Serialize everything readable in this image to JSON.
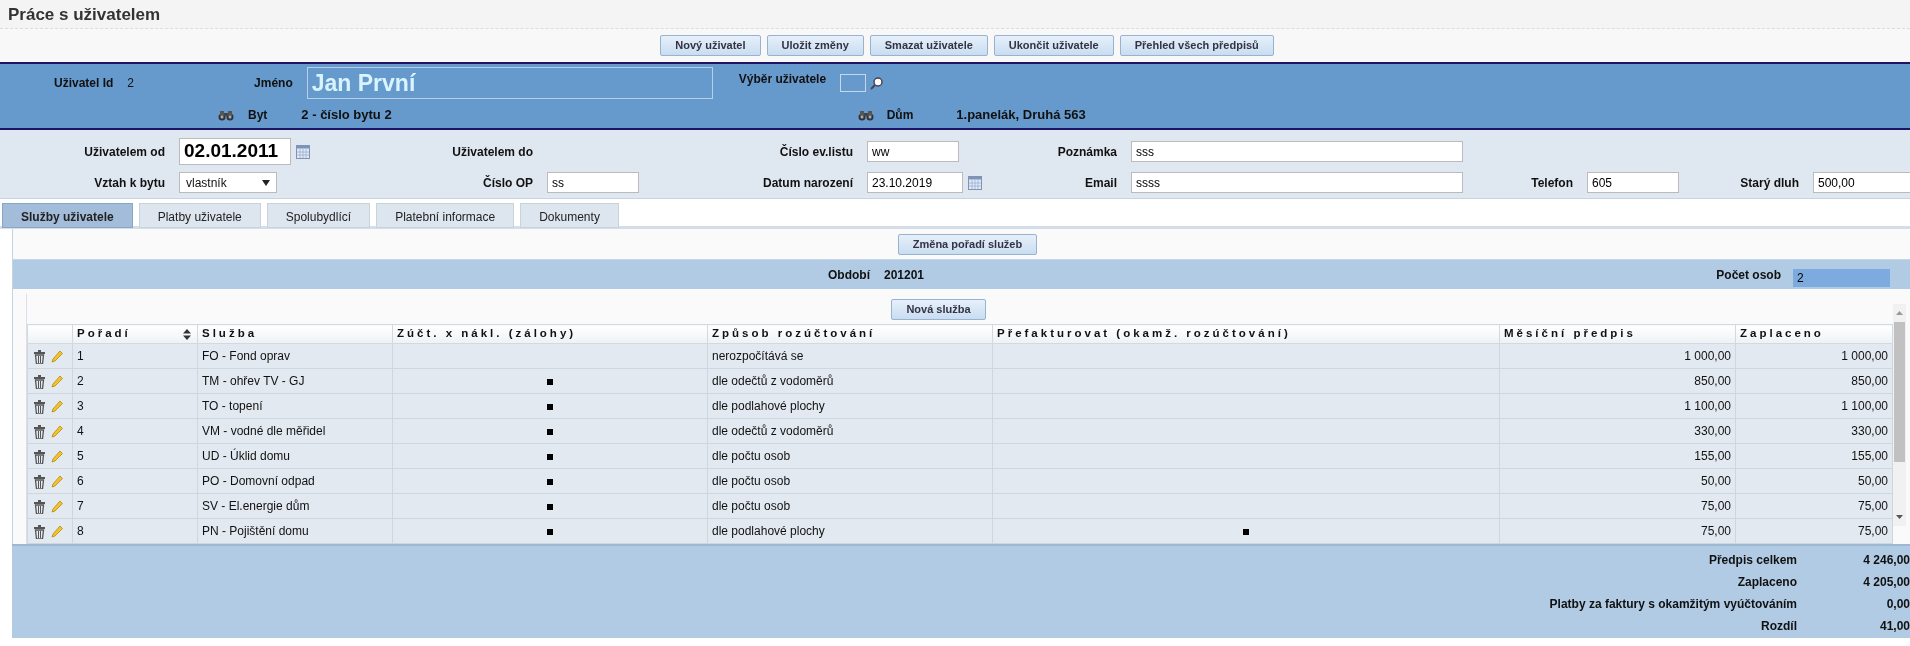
{
  "page_title": "Práce s uživatelem",
  "toolbar": [
    {
      "label": "Nový uživatel"
    },
    {
      "label": "Uložit změny"
    },
    {
      "label": "Smazat uživatele"
    },
    {
      "label": "Ukončit uživatele"
    },
    {
      "label": "Přehled všech předpisů"
    }
  ],
  "user_header": {
    "id_label": "Uživatel Id",
    "id_value": "2",
    "name_label": "Jméno",
    "name_value": "Jan První",
    "picker_label": "Výběr uživatele",
    "flat_label": "Byt",
    "flat_value": "2 - číslo bytu 2",
    "house_label": "Dům",
    "house_value": "1.panelák, Druhá 563"
  },
  "form_rows": [
    [
      {
        "label": "Uživatelem od",
        "kind": "date_large",
        "value": "02.01.2011"
      },
      {
        "label": "Uživatelem do",
        "kind": "none"
      },
      {
        "label": "Číslo ev.listu",
        "kind": "text",
        "value": "ww"
      },
      {
        "label": "Poznámka",
        "kind": "wide",
        "value": "sss"
      }
    ],
    [
      {
        "label": "Vztah k bytu",
        "kind": "select",
        "value": "vlastník"
      },
      {
        "label": "Číslo OP",
        "kind": "text",
        "value": "ss"
      },
      {
        "label": "Datum narození",
        "kind": "date",
        "value": "23.10.2019"
      },
      {
        "label": "Email",
        "kind": "wide",
        "value": "ssss"
      },
      {
        "label": "Telefon",
        "kind": "text",
        "value": "605"
      },
      {
        "label": "Starý dluh",
        "kind": "text",
        "value": "500,00"
      }
    ]
  ],
  "tabs": [
    {
      "label": "Služby uživatele",
      "selected": true
    },
    {
      "label": "Platby uživatele",
      "selected": false
    },
    {
      "label": "Spolubydlící",
      "selected": false
    },
    {
      "label": "Platební informace",
      "selected": false
    },
    {
      "label": "Dokumenty",
      "selected": false
    }
  ],
  "reorder_button": "Změna pořadí služeb",
  "period": {
    "label": "Období",
    "value": "201201",
    "persons_label": "Počet osob",
    "persons_value": "2"
  },
  "new_service_button": "Nová služba",
  "table": {
    "columns": [
      "Pořadí",
      "Služba",
      "Zúčt. x nákl. (zálohy)",
      "Způsob rozúčtování",
      "Přefakturovat (okamž. rozúčtování)",
      "Měsíční předpis",
      "Zaplaceno"
    ],
    "rows": [
      {
        "order": "1",
        "service": "FO - Fond oprav",
        "advance": false,
        "method": "nerozpočítává se",
        "rebill": false,
        "monthly": "1 000,00",
        "paid": "1 000,00"
      },
      {
        "order": "2",
        "service": "TM - ohřev TV - GJ",
        "advance": true,
        "method": "dle odečtů z vodoměrů",
        "rebill": false,
        "monthly": "850,00",
        "paid": "850,00"
      },
      {
        "order": "3",
        "service": "TO - topení",
        "advance": true,
        "method": "dle podlahové plochy",
        "rebill": false,
        "monthly": "1 100,00",
        "paid": "1 100,00"
      },
      {
        "order": "4",
        "service": "VM - vodné dle měřidel",
        "advance": true,
        "method": "dle odečtů z vodoměrů",
        "rebill": false,
        "monthly": "330,00",
        "paid": "330,00"
      },
      {
        "order": "5",
        "service": "UD - Úklid domu",
        "advance": true,
        "method": "dle počtu osob",
        "rebill": false,
        "monthly": "155,00",
        "paid": "155,00"
      },
      {
        "order": "6",
        "service": "PO - Domovní odpad",
        "advance": true,
        "method": "dle počtu osob",
        "rebill": false,
        "monthly": "50,00",
        "paid": "50,00"
      },
      {
        "order": "7",
        "service": "SV - El.energie dům",
        "advance": true,
        "method": "dle počtu osob",
        "rebill": false,
        "monthly": "75,00",
        "paid": "75,00"
      },
      {
        "order": "8",
        "service": "PN - Pojištění domu",
        "advance": true,
        "method": "dle podlahové plochy",
        "rebill": true,
        "monthly": "75,00",
        "paid": "75,00"
      }
    ]
  },
  "summary": [
    {
      "label": "Předpis celkem",
      "value": "4 246,00"
    },
    {
      "label": "Zaplaceno",
      "value": "4 205,00"
    },
    {
      "label": "Platby za faktury s okamžitým vyúčtováním",
      "value": "0,00"
    },
    {
      "label": "Rozdíl",
      "value": "41,00"
    }
  ]
}
